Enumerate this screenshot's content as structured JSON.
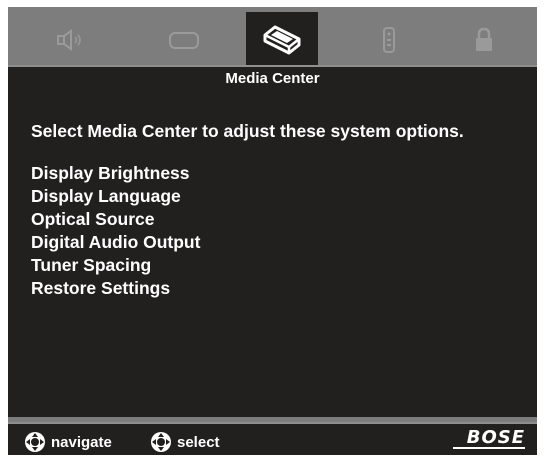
{
  "tabs": [
    {
      "name": "speaker-icon",
      "active": false
    },
    {
      "name": "display-icon",
      "active": false
    },
    {
      "name": "media-center-icon",
      "active": true
    },
    {
      "name": "remote-icon",
      "active": false
    },
    {
      "name": "lock-icon",
      "active": false
    }
  ],
  "panel": {
    "title": "Media Center",
    "instruction": "Select Media Center to adjust these system options.",
    "items": [
      "Display Brightness",
      "Display Language",
      "Optical Source",
      "Digital Audio Output",
      "Tuner Spacing",
      "Restore Settings"
    ]
  },
  "footer": {
    "navigate_label": "navigate",
    "select_label": "select",
    "brand": "BOSE"
  },
  "colors": {
    "frame": "#7d7d7d",
    "panel": "#221f1f",
    "text": "#ffffff",
    "inactive_icon": "#9a9a9a"
  }
}
